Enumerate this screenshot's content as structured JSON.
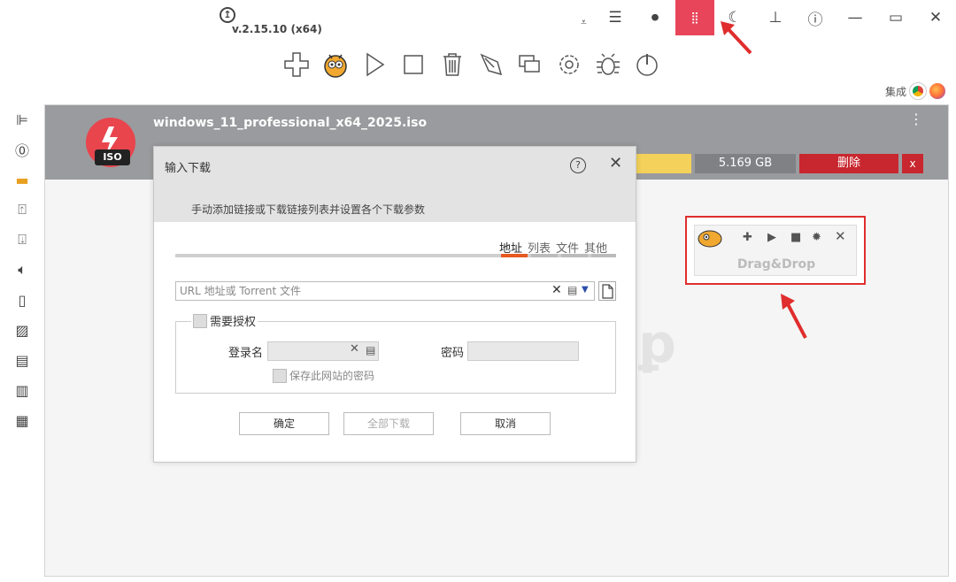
{
  "titlebar": {
    "version": "v.2.15.10 (x64)",
    "buttons": [
      {
        "name": "menu-icon",
        "glyph": "☰"
      },
      {
        "name": "record-icon",
        "glyph": "◉"
      },
      {
        "name": "dragdrop-toggle-icon",
        "glyph": "⣿"
      },
      {
        "name": "moon-icon",
        "glyph": "☾"
      },
      {
        "name": "pin-icon",
        "glyph": "⊥"
      },
      {
        "name": "help-icon",
        "glyph": "?"
      },
      {
        "name": "minimize-icon",
        "glyph": "—"
      },
      {
        "name": "maximize-icon",
        "glyph": "▭"
      },
      {
        "name": "close-icon",
        "glyph": "✕"
      }
    ],
    "active_color": "#e8455a"
  },
  "integrate": {
    "label": "集成"
  },
  "download": {
    "filename": "windows_11_professional_x64_2025.iso",
    "icon_label": "ISO",
    "size": "5.169 GB",
    "delete_label": "删除",
    "x_label": "x"
  },
  "dialog": {
    "title": "输入下载",
    "subtitle": "手动添加链接或下载链接列表并设置各个下载参数",
    "tabs": [
      "地址",
      "列表",
      "文件",
      "其他"
    ],
    "url_placeholder": "URL 地址或 Torrent 文件",
    "auth_label": "需要授权",
    "login_label": "登录名",
    "password_label": "密码",
    "save_password_label": "保存此网站的密码",
    "ok_label": "确定",
    "download_all_label": "全部下载",
    "cancel_label": "取消"
  },
  "dragdrop": {
    "label": "Drag&Drop"
  },
  "colors": {
    "accent_red": "#e02d2d",
    "tab_active": "#e8581f"
  }
}
